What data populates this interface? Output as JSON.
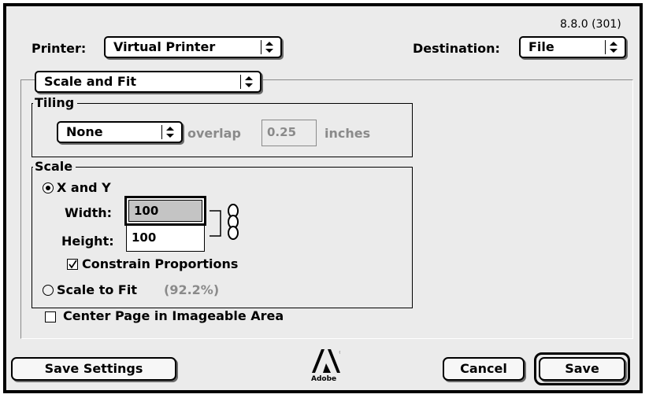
{
  "version": "8.8.0 (301)",
  "printer": {
    "label": "Printer:",
    "value": "Virtual Printer"
  },
  "destination": {
    "label": "Destination:",
    "value": "File"
  },
  "panel_select": {
    "value": "Scale and Fit"
  },
  "tiling": {
    "title": "Tiling",
    "mode": "None",
    "overlap_label": "overlap",
    "overlap_value": "0.25",
    "units": "inches"
  },
  "scale": {
    "title": "Scale",
    "x_and_y_label": "X and Y",
    "x_and_y_selected": true,
    "width_label": "Width:",
    "width_value": "100",
    "height_label": "Height:",
    "height_value": "100",
    "constrain_label": "Constrain Proportions",
    "constrain_checked": true,
    "scale_to_fit_label": "Scale to Fit",
    "scale_to_fit_value": "(92.2%)",
    "scale_to_fit_selected": false
  },
  "center_page": {
    "label": "Center Page in Imageable Area",
    "checked": false
  },
  "buttons": {
    "save_settings": "Save Settings",
    "cancel": "Cancel",
    "save": "Save"
  },
  "logo": {
    "text": "Adobe",
    "icon": "adobe-logo-icon"
  }
}
